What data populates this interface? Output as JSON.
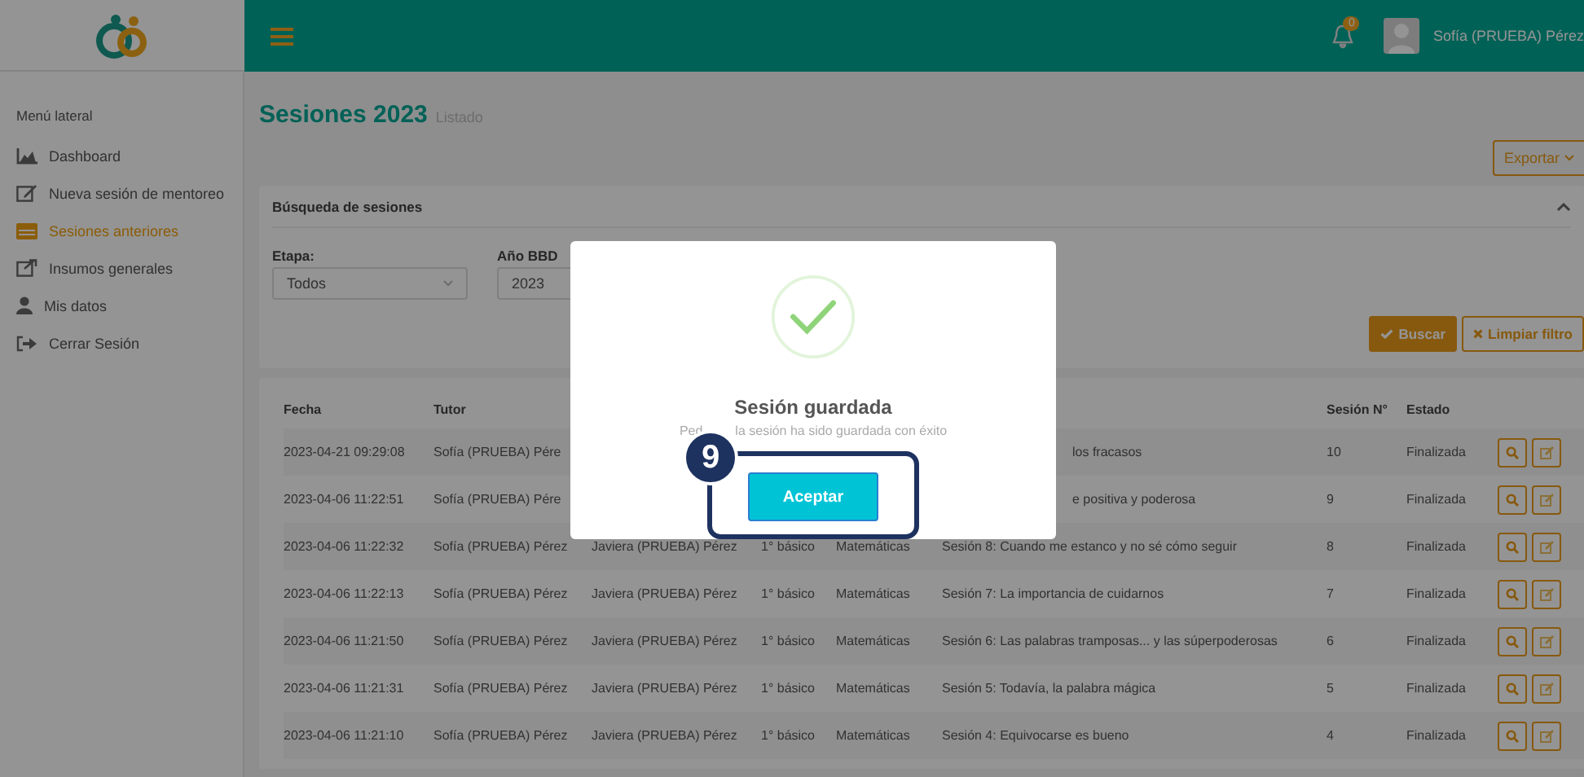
{
  "topbar": {
    "notification_count": "0",
    "user_name": "Sofía (PRUEBA) Pérez"
  },
  "sidebar": {
    "heading": "Menú lateral",
    "items": [
      {
        "label": "Dashboard",
        "selected": false
      },
      {
        "label": "Nueva sesión de mentoreo",
        "selected": false
      },
      {
        "label": "Sesiones anteriores",
        "selected": true
      },
      {
        "label": "Insumos generales",
        "selected": false
      },
      {
        "label": "Mis datos",
        "selected": false
      },
      {
        "label": "Cerrar Sesión",
        "selected": false
      }
    ]
  },
  "page": {
    "title": "Sesiones 2023",
    "subtitle": "Listado",
    "export_button": "Exportar"
  },
  "filters": {
    "title": "Búsqueda de sesiones",
    "fields": [
      {
        "label": "Etapa:",
        "value": "Todos"
      },
      {
        "label": "Año BBD",
        "value": "2023"
      }
    ],
    "search_button": "Buscar",
    "clear_button": "Limpiar filtro"
  },
  "table": {
    "columns": [
      "Fecha",
      "Tutor",
      "",
      "",
      "",
      "",
      "Sesión N°",
      "Estado"
    ],
    "rows": [
      {
        "kind": "covered",
        "fecha": "2023-04-21 09:29:08",
        "tutor": "Sofía (PRUEBA) Pére",
        "tema": "los fracasos",
        "sesion": "10",
        "estado": "Finalizada"
      },
      {
        "kind": "covered",
        "fecha": "2023-04-06 11:22:51",
        "tutor": "Sofía (PRUEBA) Pére",
        "tema": "e positiva y poderosa",
        "sesion": "9",
        "estado": "Finalizada"
      },
      {
        "kind": "full",
        "fecha": "2023-04-06 11:22:32",
        "tutor": "Sofía (PRUEBA) Pérez",
        "mentorado": "Javiera (PRUEBA) Pérez",
        "curso": "1° básico",
        "asignatura": "Matemáticas",
        "tema": "Sesión 8: Cuando me estanco y no sé cómo seguir",
        "sesion": "8",
        "estado": "Finalizada"
      },
      {
        "kind": "full",
        "fecha": "2023-04-06 11:22:13",
        "tutor": "Sofía (PRUEBA) Pérez",
        "mentorado": "Javiera (PRUEBA) Pérez",
        "curso": "1° básico",
        "asignatura": "Matemáticas",
        "tema": "Sesión 7: La importancia de cuidarnos",
        "sesion": "7",
        "estado": "Finalizada"
      },
      {
        "kind": "full",
        "fecha": "2023-04-06 11:21:50",
        "tutor": "Sofía (PRUEBA) Pérez",
        "mentorado": "Javiera (PRUEBA) Pérez",
        "curso": "1° básico",
        "asignatura": "Matemáticas",
        "tema": "Sesión 6: Las palabras tramposas... y las súperpoderosas",
        "sesion": "6",
        "estado": "Finalizada"
      },
      {
        "kind": "full",
        "fecha": "2023-04-06 11:21:31",
        "tutor": "Sofía (PRUEBA) Pérez",
        "mentorado": "Javiera (PRUEBA) Pérez",
        "curso": "1° básico",
        "asignatura": "Matemáticas",
        "tema": "Sesión 5: Todavía, la palabra mágica",
        "sesion": "5",
        "estado": "Finalizada"
      },
      {
        "kind": "full",
        "fecha": "2023-04-06 11:21:10",
        "tutor": "Sofía (PRUEBA) Pérez",
        "mentorado": "Javiera (PRUEBA) Pérez",
        "curso": "1° básico",
        "asignatura": "Matemáticas",
        "tema": "Sesión 4: Equivocarse es bueno",
        "sesion": "4",
        "estado": "Finalizada"
      }
    ]
  },
  "modal": {
    "title": "Sesión guardada",
    "message_parts": [
      "Ped",
      "la sesión ha sido guardada con éxito"
    ],
    "accept_button": "Aceptar",
    "step_marker": "9"
  }
}
